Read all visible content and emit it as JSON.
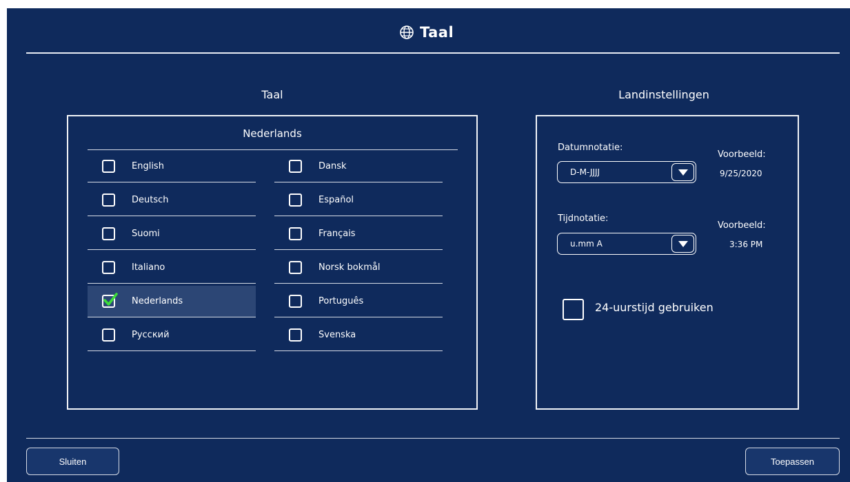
{
  "header": {
    "title": "Taal",
    "icon": "globe-icon"
  },
  "language_section": {
    "title": "Taal",
    "current": "Nederlands",
    "left_column": [
      {
        "label": "English",
        "checked": false
      },
      {
        "label": "Deutsch",
        "checked": false
      },
      {
        "label": "Suomi",
        "checked": false
      },
      {
        "label": "Italiano",
        "checked": false
      },
      {
        "label": "Nederlands",
        "checked": true
      },
      {
        "label": "Русский",
        "checked": false
      }
    ],
    "right_column": [
      {
        "label": "Dansk",
        "checked": false
      },
      {
        "label": "Español",
        "checked": false
      },
      {
        "label": "Français",
        "checked": false
      },
      {
        "label": "Norsk bokmål",
        "checked": false
      },
      {
        "label": "Português",
        "checked": false
      },
      {
        "label": "Svenska",
        "checked": false
      }
    ]
  },
  "locale_section": {
    "title": "Landinstellingen",
    "date": {
      "label": "Datumnotatie:",
      "value": "D-M-JJJJ",
      "example_label": "Voorbeeld:",
      "example_value": "9/25/2020"
    },
    "time": {
      "label": "Tijdnotatie:",
      "value": "u.mm A",
      "example_label": "Voorbeeld:",
      "example_value": "3:36 PM"
    },
    "use_24h": {
      "label": "24-uurstijd gebruiken",
      "checked": false
    }
  },
  "footer": {
    "close_label": "Sluiten",
    "apply_label": "Toepassen"
  },
  "colors": {
    "background": "#0f2a5c",
    "selected_row": "#2c4675",
    "checkmark": "#3ddc3a",
    "text": "#ffffff"
  }
}
